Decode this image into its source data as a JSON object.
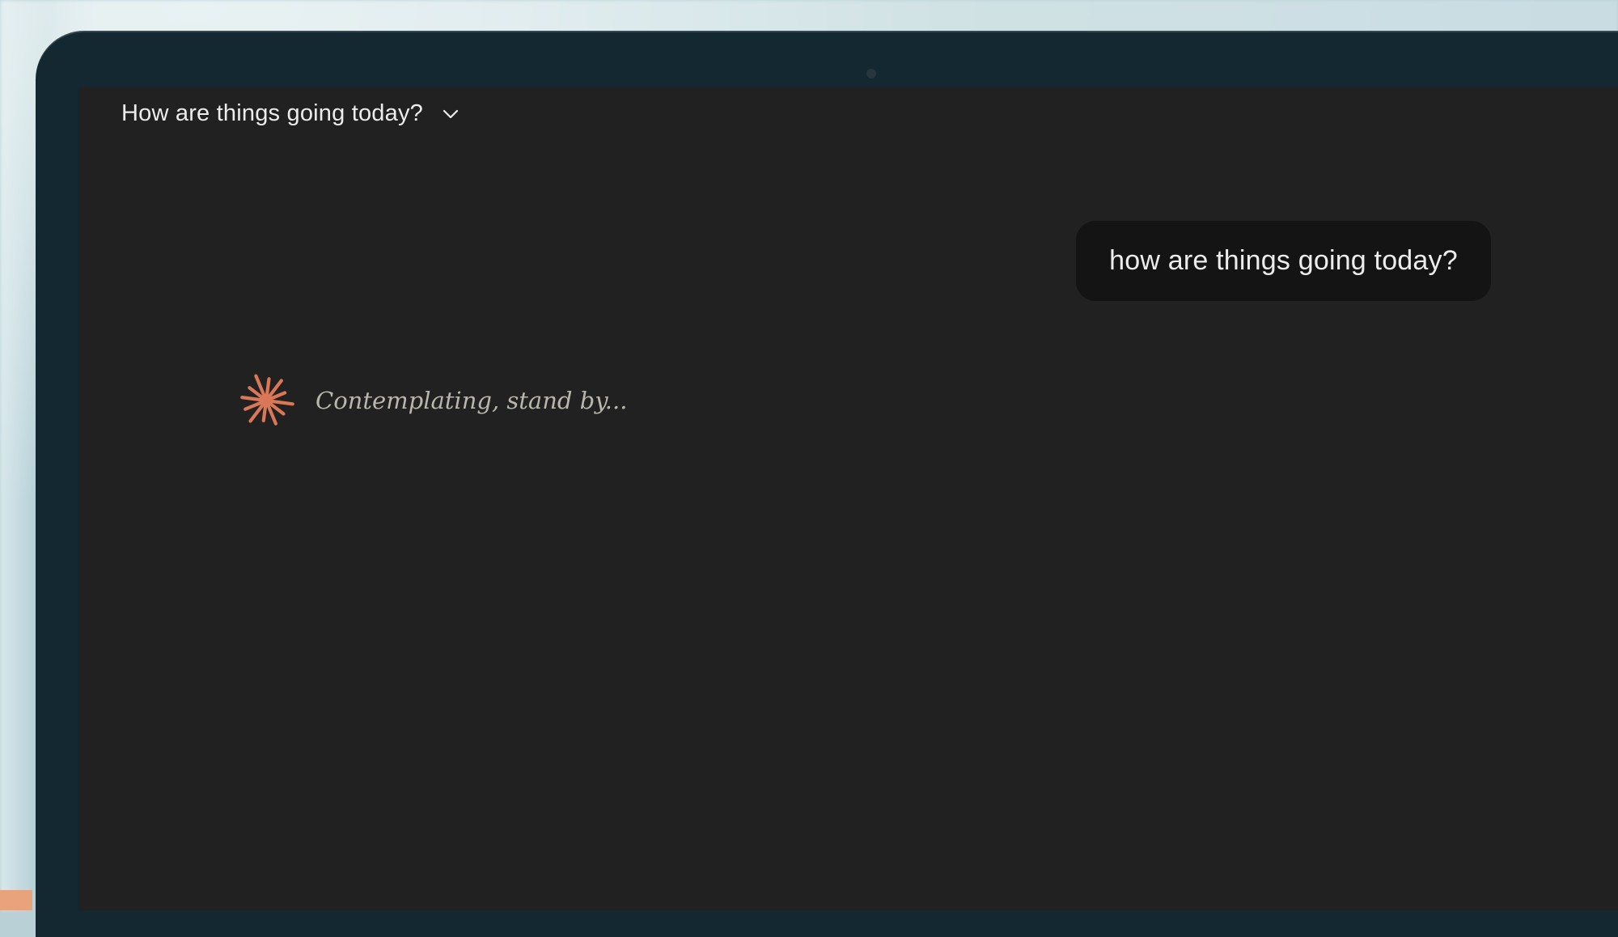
{
  "conversation": {
    "title": "How are things going today?"
  },
  "messages": {
    "user": "how are things going today?"
  },
  "assistant": {
    "status": "Contemplating, stand by..."
  },
  "colors": {
    "accent": "#d97757",
    "screen_bg": "#212121",
    "bubble_bg": "#141414",
    "text": "#ececec",
    "status_text": "#b9b6ae"
  },
  "icons": {
    "title_dropdown": "chevron-down-icon",
    "assistant_thinking": "spark-icon"
  }
}
